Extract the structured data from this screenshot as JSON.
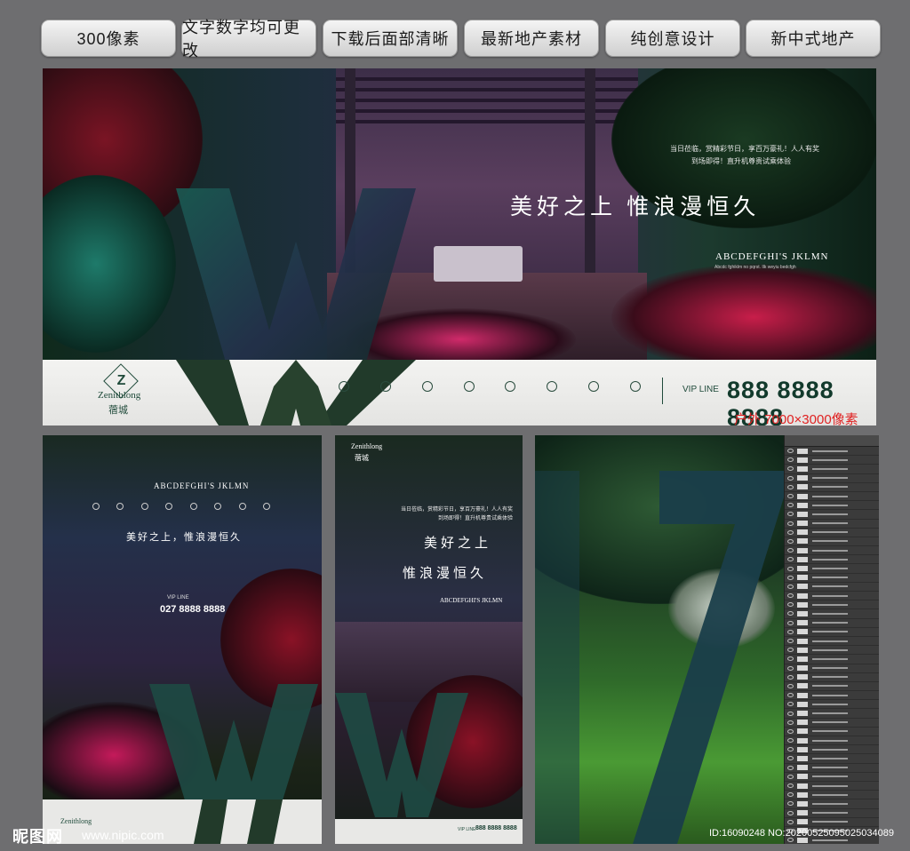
{
  "tags": [
    "300像素",
    "文字数字均可更改",
    "下载后面部清晰",
    "最新地产素材",
    "纯创意设计",
    "新中式地产"
  ],
  "banner": {
    "headline": "美好之上  惟浪漫恒久",
    "small_line1": "当日莅临，赏精彩节日，享百万豪礼！人人有奖",
    "small_line2": "到场即得！直升机尊贵试乘体验",
    "subtitle_en": "ABCDEFGHI'S  JKLMN",
    "subtitle_small": "Abcdc fghiklm no pqrst. Ilk weyiu bedcfgh",
    "logo_en": "Zenithlong",
    "logo_cn": "蓿城",
    "vip_label": "VIP LINE",
    "phone": "888 8888 8888",
    "outdoor_label": "户外  7000×3000像素"
  },
  "poster1": {
    "subtitle_en": "ABCDEFGHI'S  JKLMN",
    "headline": "美好之上，惟浪漫恒久",
    "vip_label": "VIP LINE",
    "phone": "027 8888 8888",
    "logo_en": "Zenithlong"
  },
  "poster2": {
    "logo_en": "Zenithlong",
    "logo_cn": "蓿城",
    "small_line1": "当日莅临，赏精彩节日，享百万豪礼！人人有奖",
    "small_line2": "到场即得！直升机尊贵试乘体验",
    "headline1": "美好之上",
    "headline2": "惟浪漫恒久",
    "subtitle_en": "ABCDEFGHI'S  JKLMN",
    "vip_label": "VIP LINE",
    "phone": "888 8888 8888"
  },
  "watermark": {
    "brand": "昵图网",
    "url": "www.nipic.com"
  },
  "image_id": "ID:16090248 NO:20200525095025034089"
}
